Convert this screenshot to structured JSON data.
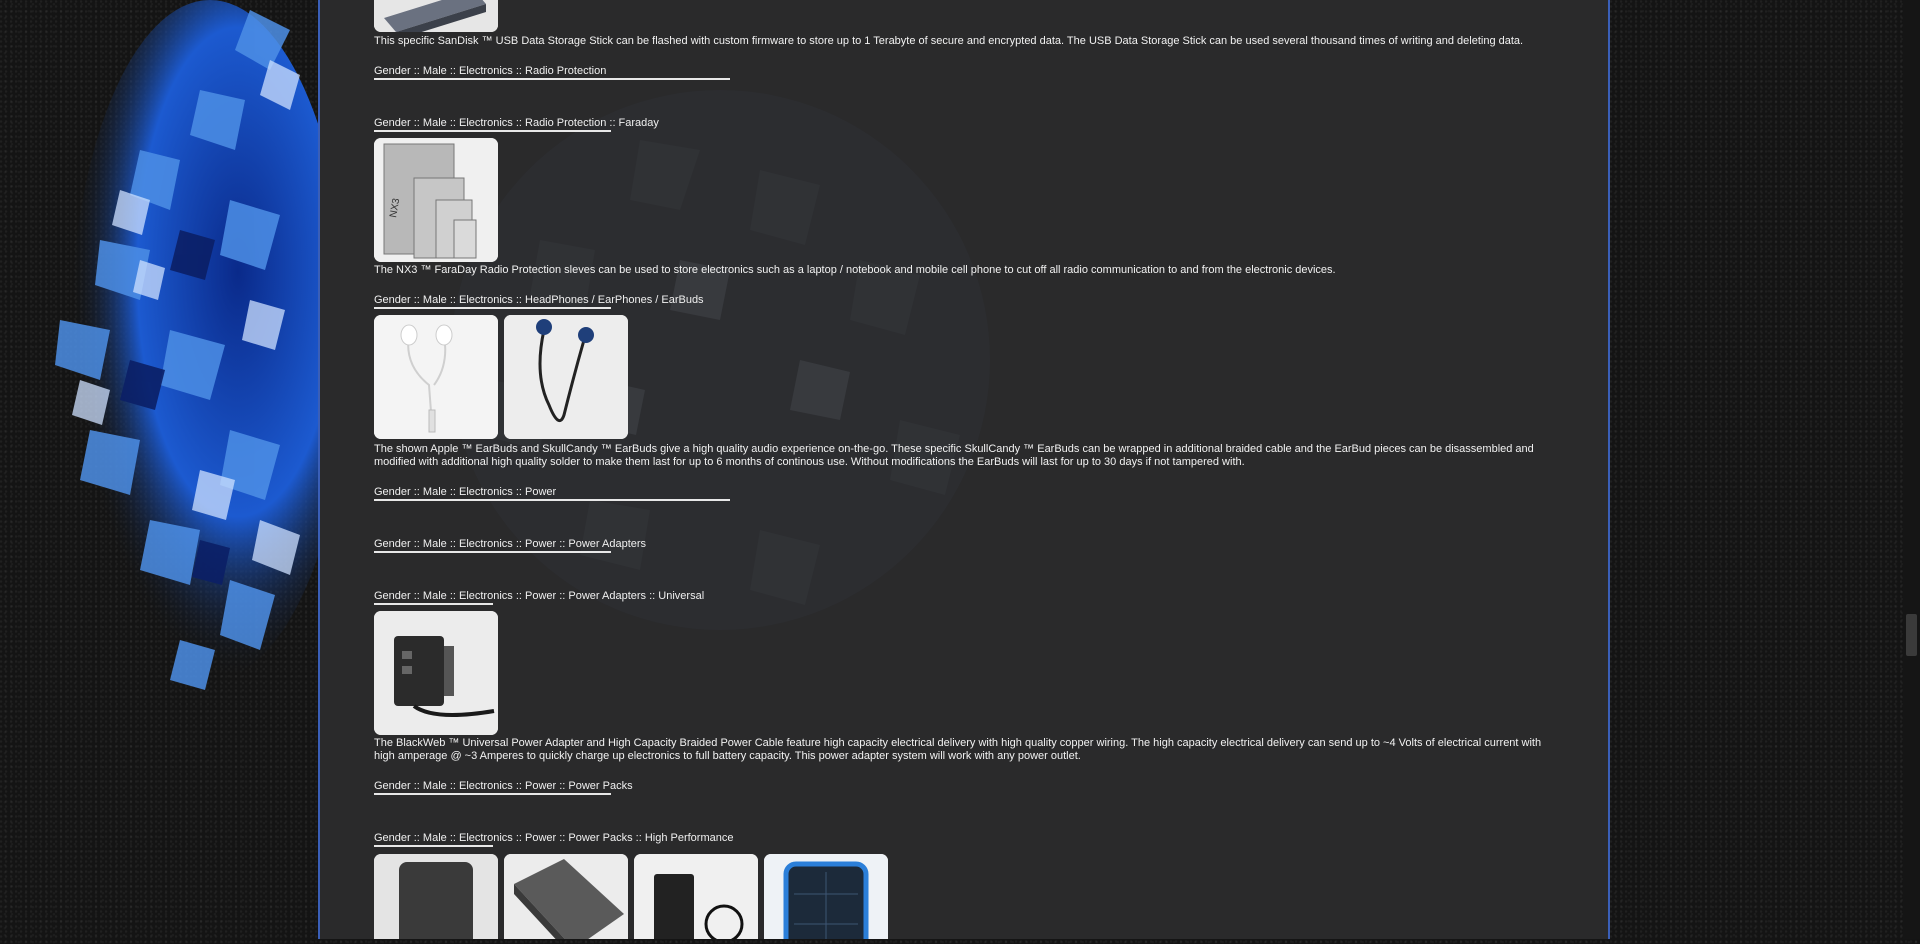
{
  "sections": {
    "usb_desc": "This specific SanDisk ™ USB Data Storage Stick can be flashed with custom firmware to store up to 1 Terabyte of secure and encrypted data. The USB Data Storage Stick can be used several thousand times of writing and deleting data.",
    "radio_protection": "Gender :: Male :: Electronics :: Radio Protection",
    "faraday": "Gender :: Male :: Electronics :: Radio Protection :: Faraday",
    "faraday_desc": "The NX3 ™ FaraDay Radio Protection sleves can be used to store electronics such as a laptop / notebook and mobile cell phone to cut off all radio communication to and from the electronic devices.",
    "headphones": "Gender :: Male :: Electronics :: HeadPhones / EarPhones / EarBuds",
    "headphones_desc_1": "The shown Apple ™ EarBuds and SkullCandy ™ EarBuds give a high quality audio experience on-the-go. These specific SkullCandy ™ EarBuds can be wrapped in additional braided cable and the EarBud pieces can be disassembled and",
    "headphones_desc_2": "modified with additional high quality solder to make them last for up to 6 months of continous use. Without modifications the EarBuds will last for up to 30 days if not tampered with.",
    "power": "Gender :: Male :: Electronics :: Power",
    "power_adapters": "Gender :: Male :: Electronics :: Power :: Power Adapters",
    "universal": "Gender :: Male :: Electronics :: Power :: Power Adapters :: Universal",
    "universal_desc_1": "The BlackWeb ™ Universal Power Adapter and High Capacity Braided Power Cable feature high capacity electrical delivery with high quality copper wiring. The high capacity electrical delivery can send up to ~4 Volts of electrical current with",
    "universal_desc_2": "high amperage @ ~3 Amperes to quickly charge up electronics to full battery capacity. This power adapter system will work with any power outlet.",
    "power_packs": "Gender :: Male :: Electronics :: Power :: Power Packs",
    "high_performance": "Gender :: Male :: Electronics :: Power :: Power Packs :: High Performance"
  },
  "colors": {
    "accent_border": "#3a5fb8",
    "panel_bg": "#2a2a2b",
    "text": "#f2f2f2"
  },
  "icons": [
    "usb-stick-image",
    "faraday-bag-image",
    "apple-earbuds-image",
    "skullcandy-earbuds-image",
    "power-adapter-image",
    "power-pack-image",
    "power-pack-image",
    "power-pack-cable-image",
    "solar-power-pack-image"
  ]
}
